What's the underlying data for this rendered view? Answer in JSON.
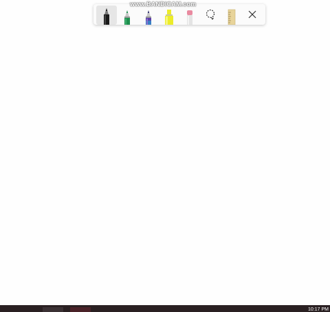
{
  "watermark": "www.BANDICAM.com",
  "toolbar": {
    "tools": [
      {
        "name": "ballpoint-pen",
        "color": "#1a1a1a",
        "selected": true
      },
      {
        "name": "pen",
        "color": "#1f8f4e"
      },
      {
        "name": "calligraphy-pen",
        "color": "#5b3ea8"
      },
      {
        "name": "highlighter",
        "color": "#ecec2a"
      },
      {
        "name": "eraser",
        "color": "#e98aa0"
      },
      {
        "name": "lasso-select-icon"
      },
      {
        "name": "ruler-icon",
        "color": "#e8d49a"
      },
      {
        "name": "close-icon"
      }
    ]
  },
  "taskbar": {
    "clock": "10:17 PM"
  }
}
